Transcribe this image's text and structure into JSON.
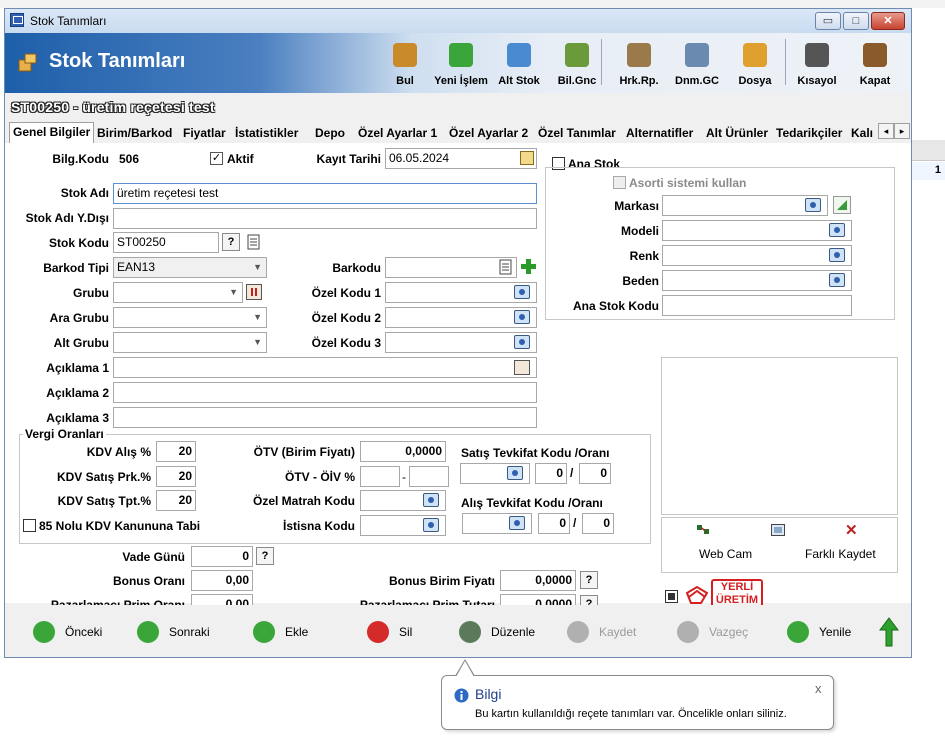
{
  "window": {
    "title": "Stok Tanımları",
    "header_title": "Stok Tanımları",
    "min_glyph": "▭",
    "max_glyph": "□",
    "close_glyph": "✕"
  },
  "toolbar": [
    {
      "label": "Bul",
      "icon": "search-icon",
      "color": "#c98a2b"
    },
    {
      "label": "Yeni İşlem",
      "icon": "add-icon",
      "color": "#3aa63a"
    },
    {
      "label": "Alt Stok",
      "icon": "substock-icon",
      "color": "#4a8ad0"
    },
    {
      "label": "Bil.Gnc",
      "icon": "money-refresh-icon",
      "color": "#6a9a3a"
    },
    {
      "label": "Hrk.Rp.",
      "icon": "report-icon",
      "color": "#9a7a4a"
    },
    {
      "label": "Dnm.GC",
      "icon": "document-search-icon",
      "color": "#6a8ab0"
    },
    {
      "label": "Dosya",
      "icon": "folder-icon",
      "color": "#e0a030"
    },
    {
      "label": "Kısayol",
      "icon": "keyboard-icon",
      "color": "#555555"
    },
    {
      "label": "Kapat",
      "icon": "exit-door-icon",
      "color": "#8a5a2a"
    }
  ],
  "record": {
    "code": "ST00250",
    "separator": "-",
    "name": "üretim reçetesi test"
  },
  "tabs": [
    "Genel Bilgiler",
    "Birim/Barkod",
    "Fiyatlar",
    "İstatistikler",
    "Depo",
    "Özel Ayarlar 1",
    "Özel Ayarlar 2",
    "Özel Tanımlar",
    "Alternatifler",
    "Alt Ürünler",
    "Tedarikçiler",
    "Kalı"
  ],
  "tab_arrows": {
    "left": "◂",
    "right": "▸"
  },
  "form": {
    "bilg_kodu_label": "Bilg.Kodu",
    "bilg_kodu_value": "506",
    "aktif_label": "Aktif",
    "aktif_checked": "✓",
    "kayit_tarihi_label": "Kayıt Tarihi",
    "kayit_tarihi_value": "06.05.2024",
    "stok_adi_label": "Stok Adı",
    "stok_adi_value": "üretim reçetesi test",
    "stok_adi_yd_label": "Stok Adı Y.Dışı",
    "stok_adi_yd_value": "",
    "stok_kodu_label": "Stok Kodu",
    "stok_kodu_value": "ST00250",
    "stok_kodu_help": "?",
    "barkod_tipi_label": "Barkod Tipi",
    "barkod_tipi_value": "EAN13",
    "barkodu_label": "Barkodu",
    "barkodu_value": "",
    "grubu_label": "Grubu",
    "ara_grubu_label": "Ara Grubu",
    "alt_grubu_label": "Alt Grubu",
    "ozel_kodu_1_label": "Özel Kodu 1",
    "ozel_kodu_2_label": "Özel Kodu 2",
    "ozel_kodu_3_label": "Özel Kodu 3",
    "aciklama_1_label": "Açıklama 1",
    "aciklama_2_label": "Açıklama 2",
    "aciklama_3_label": "Açıklama 3",
    "ana_stok_label": "Ana Stok",
    "asorti_label": "Asorti sistemi kullan",
    "markasi_label": "Markası",
    "modeli_label": "Modeli",
    "renk_label": "Renk",
    "beden_label": "Beden",
    "ana_stok_kodu_label": "Ana Stok Kodu"
  },
  "vergi": {
    "title": "Vergi Oranları",
    "kdv_alis_label": "KDV Alış %",
    "kdv_alis_value": "20",
    "kdv_satis_prk_label": "KDV Satış Prk.%",
    "kdv_satis_prk_value": "20",
    "kdv_satis_tpt_label": "KDV Satış Tpt.%",
    "kdv_satis_tpt_value": "20",
    "kanun_label": "85 Nolu KDV Kanununa Tabi",
    "otv_label": "ÖTV (Birim Fiyatı)",
    "otv_value": "0,0000",
    "otv_oiv_label": "ÖTV - ÖİV %",
    "otv_oiv_sep": "-",
    "ozel_matrah_label": "Özel Matrah Kodu",
    "istisna_label": "İstisna Kodu",
    "satis_tevkifat_label": "Satış Tevkifat Kodu /Oranı",
    "satis_tevkifat_a": "0",
    "satis_tevkifat_b": "0",
    "alis_tevkifat_label": "Alış Tevkifat Kodu /Oranı",
    "alis_tevkifat_a": "0",
    "alis_tevkifat_b": "0",
    "slash": "/"
  },
  "alt": {
    "vade_label": "Vade Günü",
    "vade_value": "0",
    "bonus_orani_label": "Bonus Oranı",
    "bonus_orani_value": "0,00",
    "pazarlamaci_orani_label": "Pazarlamacı Prim Oranı",
    "pazarlamaci_orani_value": "0,00",
    "bonus_birim_label": "Bonus Birim Fiyatı",
    "bonus_birim_value": "0,0000",
    "pazarlamaci_tutari_label": "Pazarlamacı Prim Tutarı",
    "pazarlamaci_tutari_value": "0,0000",
    "help": "?"
  },
  "image_panel": {
    "webcam_label": "Web Cam",
    "save_as_label": "Farklı Kaydet",
    "close_glyph": "✕",
    "yerli_line1": "YERLİ",
    "yerli_line2": "ÜRETİM"
  },
  "bottom": [
    {
      "label": "Önceki",
      "icon": "back-arrow-icon",
      "color": "#3aa63a",
      "enabled": true
    },
    {
      "label": "Sonraki",
      "icon": "forward-arrow-icon",
      "color": "#3aa63a",
      "enabled": true
    },
    {
      "label": "Ekle",
      "icon": "add-icon",
      "color": "#3aa63a",
      "enabled": true
    },
    {
      "label": "Sil",
      "icon": "delete-icon",
      "color": "#d42a2a",
      "enabled": true
    },
    {
      "label": "Düzenle",
      "icon": "edit-icon",
      "color": "#5a7a5a",
      "enabled": true
    },
    {
      "label": "Kaydet",
      "icon": "check-icon",
      "color": "#b0b0b0",
      "enabled": false
    },
    {
      "label": "Vazgeç",
      "icon": "cancel-icon",
      "color": "#b0b0b0",
      "enabled": false
    },
    {
      "label": "Yenile",
      "icon": "refresh-icon",
      "color": "#3aa63a",
      "enabled": true
    }
  ],
  "tooltip": {
    "title": "Bilgi",
    "message": "Bu kartın kullanıldığı reçete tanımları var. Öncelikle onları siliniz.",
    "close": "x"
  },
  "background": {
    "right_number": "1"
  }
}
